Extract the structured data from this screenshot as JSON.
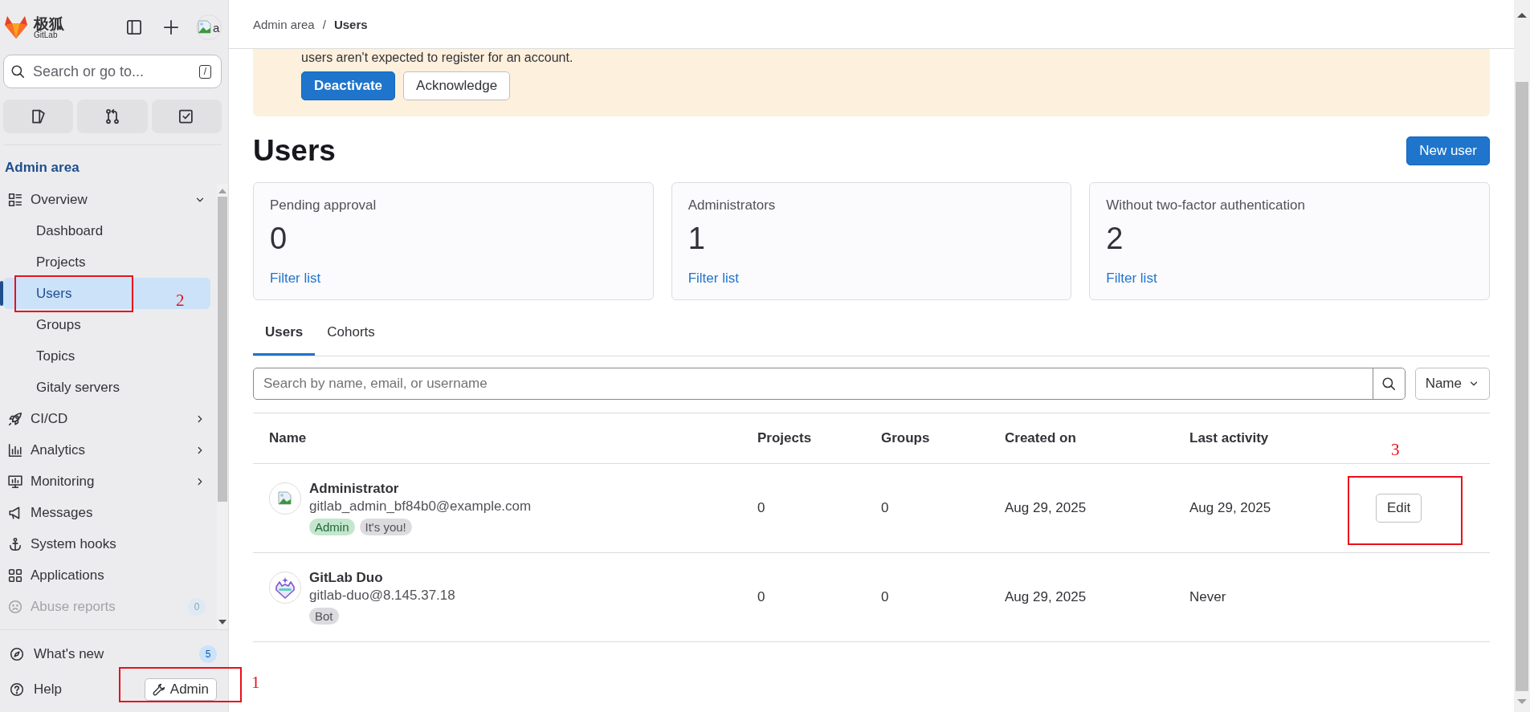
{
  "sidebar": {
    "logo": {
      "name": "极狐",
      "sub": "GitLab"
    },
    "avatar_alt": "a",
    "search": {
      "placeholder": "Search or go to...",
      "shortcut": "/"
    },
    "section_title": "Admin area",
    "nav": [
      {
        "label": "Overview",
        "expanded": true,
        "disabled": false,
        "children": [
          {
            "label": "Dashboard",
            "selected": false
          },
          {
            "label": "Projects",
            "selected": false
          },
          {
            "label": "Users",
            "selected": true
          },
          {
            "label": "Groups",
            "selected": false
          },
          {
            "label": "Topics",
            "selected": false
          },
          {
            "label": "Gitaly servers",
            "selected": false
          }
        ]
      },
      {
        "label": "CI/CD",
        "expanded": false,
        "disabled": false
      },
      {
        "label": "Analytics",
        "expanded": false,
        "disabled": false
      },
      {
        "label": "Monitoring",
        "expanded": false,
        "disabled": false
      },
      {
        "label": "Messages",
        "disabled": false
      },
      {
        "label": "System hooks",
        "disabled": false
      },
      {
        "label": "Applications",
        "disabled": false
      },
      {
        "label": "Abuse reports",
        "disabled": true,
        "badge": "0"
      }
    ],
    "bottom": [
      {
        "label": "What's new",
        "badge": "5"
      },
      {
        "label": "Help"
      }
    ],
    "admin_button": "Admin"
  },
  "breadcrumb_separator": "/",
  "breadcrumb": [
    {
      "label": "Admin area",
      "current": false
    },
    {
      "label": "Users",
      "current": true
    }
  ],
  "banner": {
    "text": "users aren't expected to register for an account.",
    "buttons": [
      {
        "label": "Deactivate",
        "kind": "primary"
      },
      {
        "label": "Acknowledge",
        "kind": "default"
      }
    ]
  },
  "title": "Users",
  "new_button": "New user",
  "stats": [
    {
      "label": "Pending approval",
      "value": "0",
      "link": "Filter list"
    },
    {
      "label": "Administrators",
      "value": "1",
      "link": "Filter list"
    },
    {
      "label": "Without two-factor authentication",
      "value": "2",
      "link": "Filter list"
    }
  ],
  "tabs": [
    {
      "label": "Users",
      "selected": true
    },
    {
      "label": "Cohorts",
      "selected": false
    }
  ],
  "search": {
    "placeholder": "Search by name, email, or username"
  },
  "sort": "Name",
  "table": {
    "columns": [
      "Name",
      "Projects",
      "Groups",
      "Created on",
      "Last activity"
    ],
    "rows": [
      {
        "is_bot": false,
        "name": "Administrator",
        "email": "gitlab_admin_bf84b0@example.com",
        "badges": [
          {
            "label": "Admin",
            "kind": "success"
          },
          {
            "label": "It's you!",
            "kind": "neutral"
          }
        ],
        "projects": "0",
        "groups": "0",
        "created": "Aug 29, 2025",
        "last_activity": "Aug 29, 2025",
        "action": "Edit"
      },
      {
        "is_bot": true,
        "name": "GitLab Duo",
        "email": "gitlab-duo@8.145.37.18",
        "badges": [
          {
            "label": "Bot",
            "kind": "neutral"
          }
        ],
        "projects": "0",
        "groups": "0",
        "created": "Aug 29, 2025",
        "last_activity": "Never"
      }
    ]
  },
  "annotations": [
    {
      "label": "1"
    },
    {
      "label": "2"
    },
    {
      "label": "3"
    }
  ]
}
